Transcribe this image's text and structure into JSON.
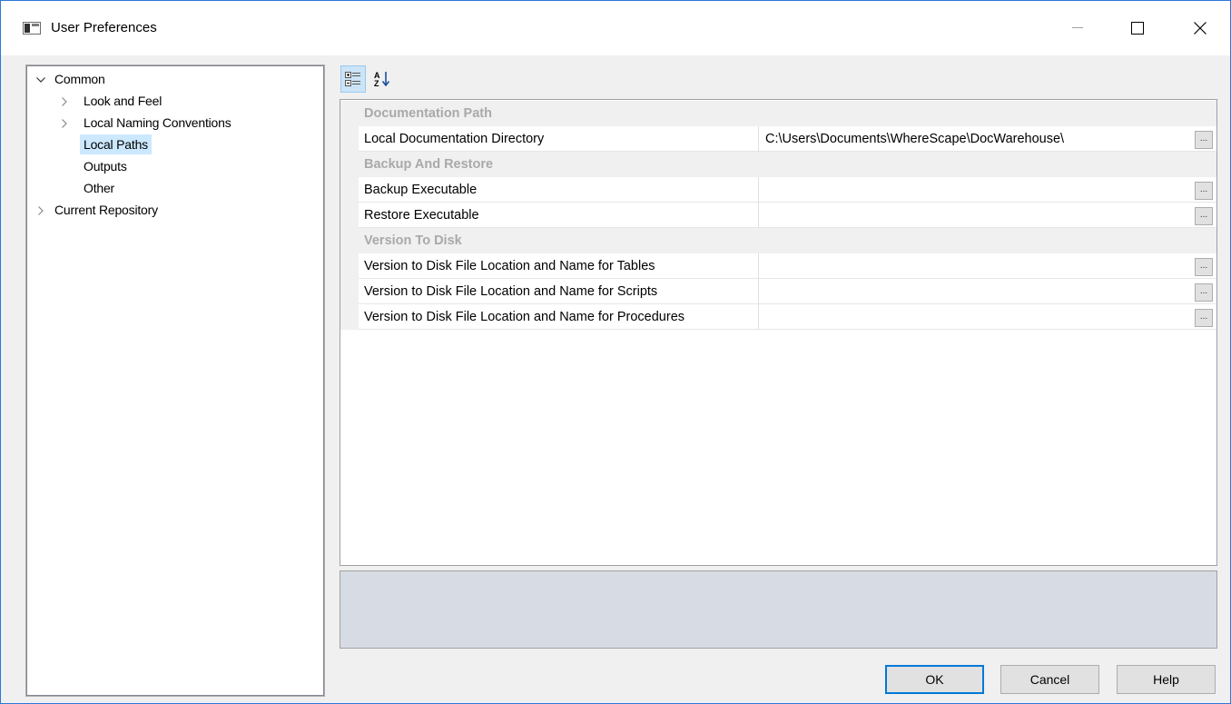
{
  "window": {
    "title": "User Preferences"
  },
  "tree": {
    "items": [
      {
        "label": "Common",
        "toggle": "expanded"
      },
      {
        "label": "Look and Feel",
        "toggle": "collapsed"
      },
      {
        "label": "Local Naming Conventions",
        "toggle": "collapsed"
      },
      {
        "label": "Local Paths",
        "toggle": "none",
        "selected": true
      },
      {
        "label": "Outputs",
        "toggle": "none"
      },
      {
        "label": "Other",
        "toggle": "none"
      },
      {
        "label": "Current Repository",
        "toggle": "collapsed"
      }
    ]
  },
  "toolbar": {
    "categorized_icon": "categorized-view-icon",
    "alphabetical_icon": "alphabetical-sort-icon",
    "alphabetical_glyph_top": "A",
    "alphabetical_glyph_bottom": "Z"
  },
  "grid": {
    "categories": [
      {
        "label": "Documentation Path",
        "properties": [
          {
            "name": "Local Documentation Directory",
            "value": "C:\\Users\\Documents\\WhereScape\\DocWarehouse\\"
          }
        ]
      },
      {
        "label": "Backup And Restore",
        "properties": [
          {
            "name": "Backup Executable",
            "value": ""
          },
          {
            "name": "Restore Executable",
            "value": ""
          }
        ]
      },
      {
        "label": "Version To Disk",
        "properties": [
          {
            "name": "Version to Disk File Location and Name for Tables",
            "value": ""
          },
          {
            "name": "Version to Disk File Location and Name for Scripts",
            "value": ""
          },
          {
            "name": "Version to Disk File Location and Name for Procedures",
            "value": ""
          }
        ]
      }
    ],
    "ellipsis_label": "..."
  },
  "description": {
    "text": ""
  },
  "buttons": {
    "ok": "OK",
    "cancel": "Cancel",
    "help": "Help"
  },
  "colors": {
    "selection": "#cce8ff",
    "accent": "#0078d7",
    "category_text": "#a9a9a9",
    "description_bg": "#d7dce4"
  }
}
